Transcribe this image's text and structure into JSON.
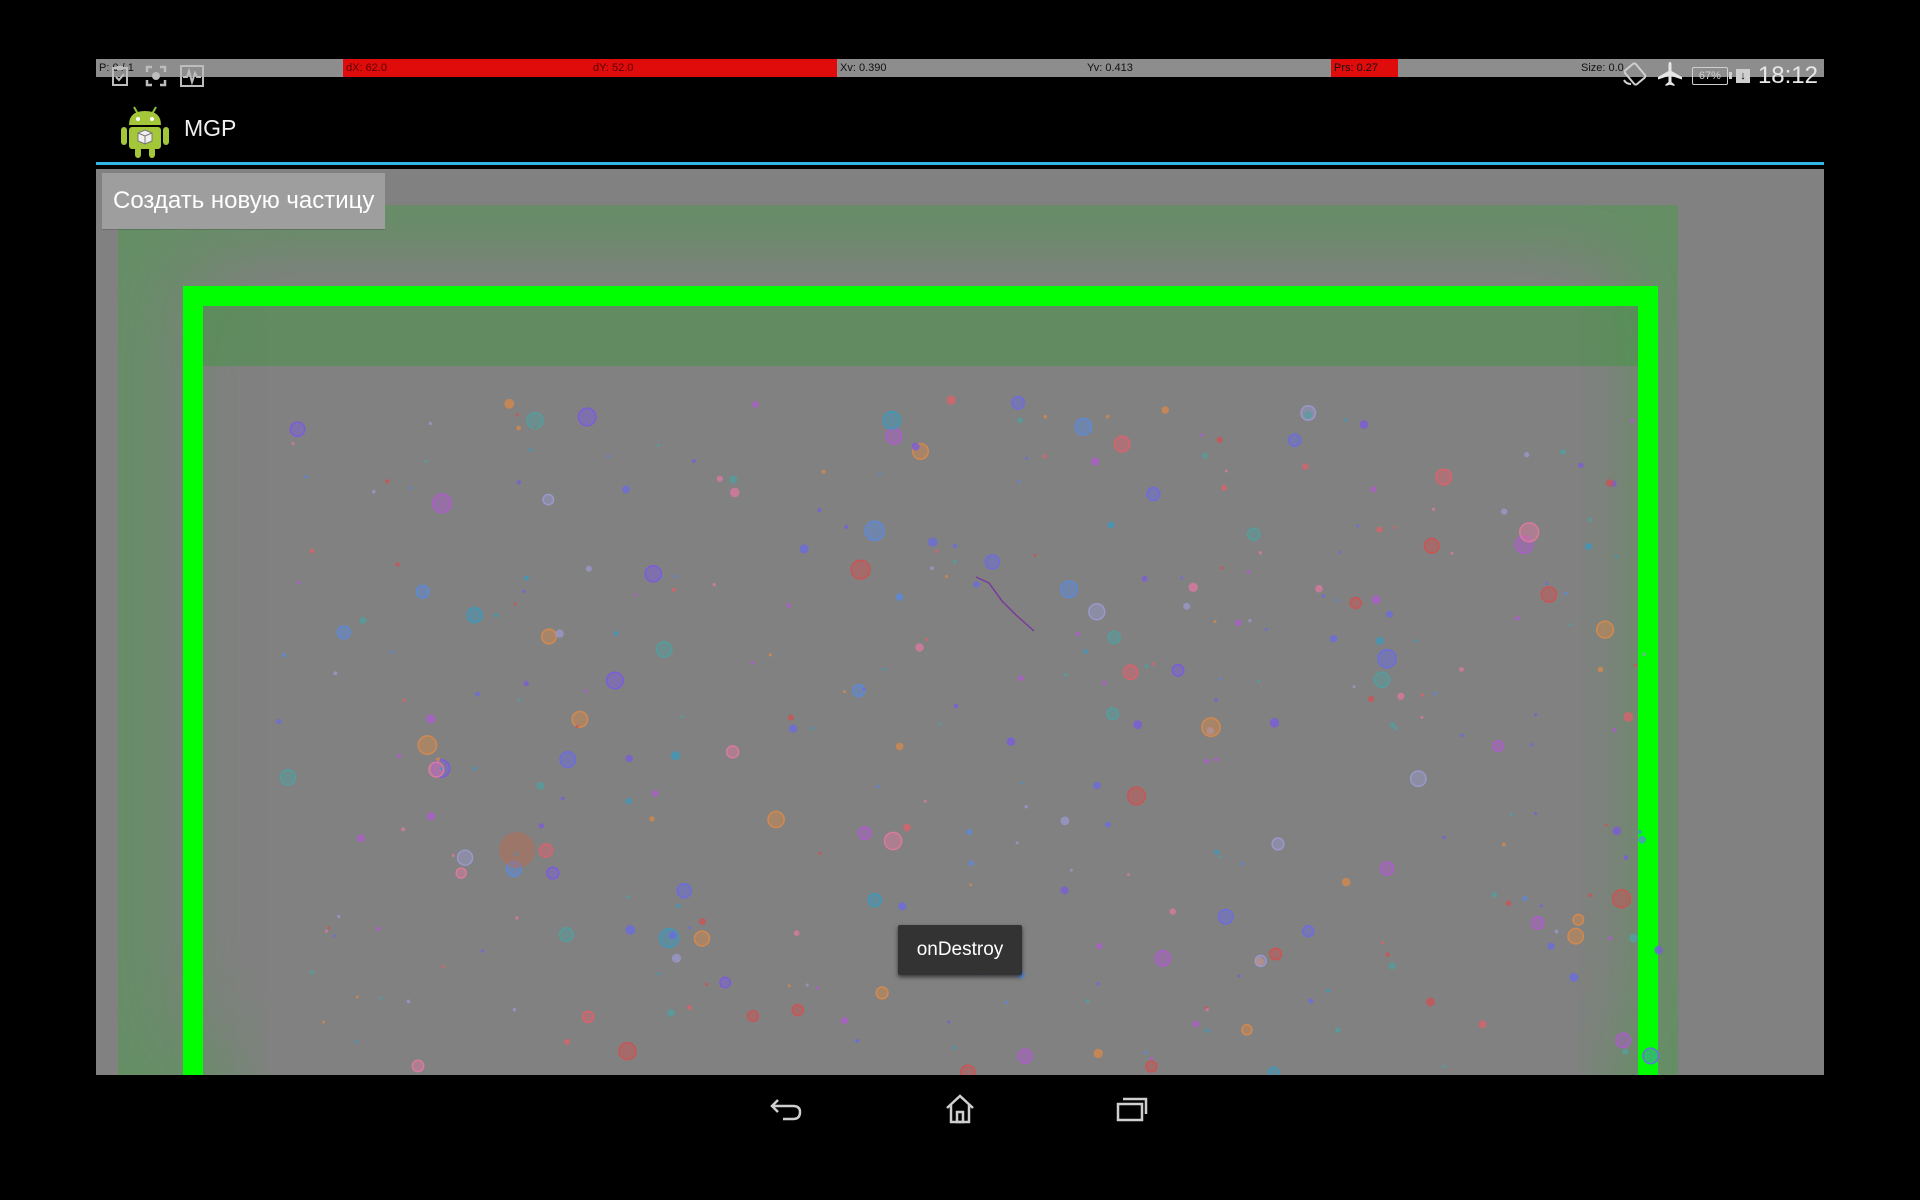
{
  "debug_bar": {
    "p": "P: 0 / 1",
    "dx": "dX: 62.0",
    "dy": "dY: 52.0",
    "xv": "Xv: 0.390",
    "yv": "Yv: 0.413",
    "prs": "Prs: 0.27",
    "pressure_fraction": 0.27,
    "size": "Size: 0.0"
  },
  "status_bar": {
    "left_icons": [
      "clipboard-icon",
      "screenshot-icon",
      "pulse-icon"
    ],
    "right_icons": [
      "rotation-lock-icon",
      "airplane-mode-icon",
      "battery-icon",
      "charging-icon"
    ],
    "battery": "67%",
    "time": "18:12"
  },
  "action_bar": {
    "title": "MGP",
    "accent_color": "#33b5e5"
  },
  "content": {
    "create_button": "Создать новую частицу",
    "frame_color": "#00ff00",
    "background_color": "#818181"
  },
  "toast": {
    "text": "onDestroy"
  },
  "nav_bar": {
    "buttons": [
      "back-icon",
      "home-icon",
      "recents-icon"
    ]
  }
}
